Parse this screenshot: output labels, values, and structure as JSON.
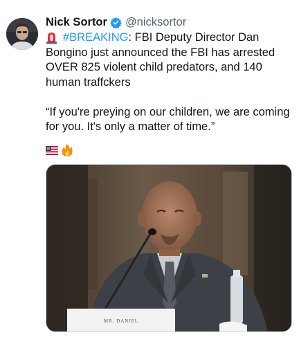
{
  "author": {
    "display_name": "Nick Sortor",
    "handle": "@nicksortor",
    "avatar_icon": "user-avatar",
    "verified_icon": "verified-badge-icon"
  },
  "tweet": {
    "line1_hashtag": "#BREAKING",
    "line1_rest": ": FBI Deputy Director Dan",
    "line2": "Bongino just announced the FBI has arrested",
    "line3": "OVER 825 violent child predators, and 140",
    "line4": "human traffckers",
    "quote_line1": "“If you're preying on our children, we are coming",
    "quote_line2": "for you. It's only a matter of time.”",
    "lead_emoji_icon": "siren-icon",
    "trailing_emoji_icons": [
      "us-flag-icon",
      "fire-icon"
    ]
  },
  "media": {
    "nameplate_text": "MR. DANIEL",
    "description_icon": "photo"
  },
  "colors": {
    "link": "#1d9bf0",
    "verified": "#1d9bf0",
    "text_primary": "#0f1419",
    "text_secondary": "#536471"
  }
}
